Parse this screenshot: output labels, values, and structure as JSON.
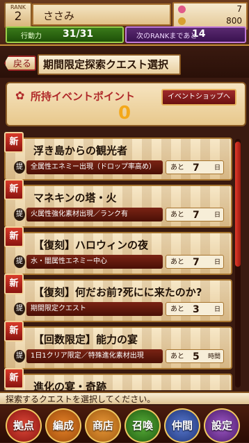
{
  "header": {
    "rank_label": "RANK",
    "rank_value": "2",
    "player_name": "ささみ",
    "resources": [
      {
        "icon": "fish-icon",
        "value": "7",
        "color": "#e05a8a"
      },
      {
        "icon": "coin-icon",
        "value": "800",
        "color": "#d8a030"
      }
    ],
    "stamina_label": "行動力",
    "stamina_value": "31/31",
    "exp_label": "次のRANKまであと",
    "exp_value": "14"
  },
  "titlebar": {
    "back_label": "戻る",
    "title": "期間限定探索クエスト選択"
  },
  "points": {
    "label": "所持イベントポイント",
    "shop_label": "イベントショップへ",
    "value": "0"
  },
  "quests": [
    {
      "name": "浮き島からの観光者",
      "desc": "全属性エネミー出現（ドロップ率高め）",
      "remain_prefix": "あと",
      "remain_num": "7",
      "remain_unit": "日"
    },
    {
      "name": "マネキンの塔・火",
      "desc": "火属性強化素材出現／ランク有",
      "remain_prefix": "あと",
      "remain_num": "7",
      "remain_unit": "日"
    },
    {
      "name": "【復刻】ハロウィンの夜",
      "desc": "水・闇属性エネミー中心",
      "remain_prefix": "あと",
      "remain_num": "7",
      "remain_unit": "日"
    },
    {
      "name": "【復刻】何だお前?死にに来たのか?",
      "desc": "期間限定クエスト",
      "remain_prefix": "あと",
      "remain_num": "3",
      "remain_unit": "日"
    },
    {
      "name": "【回数限定】能力の宴",
      "desc": "1日1クリア限定／特殊進化素材出現",
      "remain_prefix": "あと",
      "remain_num": "5",
      "remain_unit": "時間"
    },
    {
      "name": "進化の宴・奇跡",
      "desc": "",
      "remain_prefix": "",
      "remain_num": "",
      "remain_unit": ""
    }
  ],
  "badge_label": "新",
  "tei_label": "提",
  "status_text": "探索するクエストを選択してください。",
  "nav": [
    {
      "label": "拠点",
      "color": "#b82a2a"
    },
    {
      "label": "編成",
      "color": "#c8641a"
    },
    {
      "label": "商店",
      "color": "#c8781e"
    },
    {
      "label": "召喚",
      "color": "#3a8a2a"
    },
    {
      "label": "仲間",
      "color": "#3a5aa8"
    },
    {
      "label": "設定",
      "color": "#7a3a9a"
    }
  ]
}
